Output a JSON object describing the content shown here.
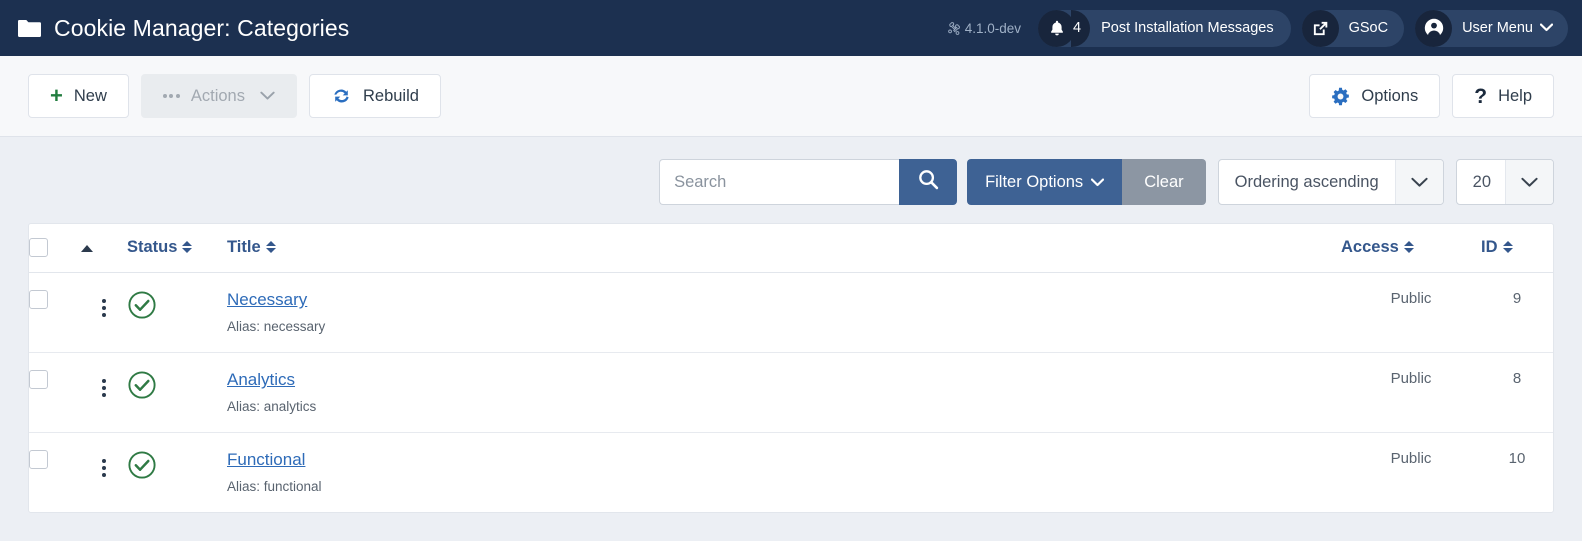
{
  "header": {
    "folder_icon": "folder-icon",
    "title": "Cookie Manager: Categories",
    "version": "4.1.0-dev",
    "joomla_icon": "joomla-logo-icon",
    "notifications": {
      "icon": "bell-icon",
      "count": "4",
      "label": "Post Installation Messages"
    },
    "gsoc": {
      "icon": "external-link-icon",
      "label": "GSoC"
    },
    "user_menu": {
      "icon": "user-avatar-icon",
      "label": "User Menu",
      "caret": "⌄"
    }
  },
  "toolbar": {
    "left": [
      {
        "name": "new-button",
        "icon": "plus-icon",
        "label": "New",
        "disabled": false
      },
      {
        "name": "actions-button",
        "icon": "ellipsis-icon",
        "label": "Actions",
        "disabled": true
      },
      {
        "name": "rebuild-button",
        "icon": "refresh-icon",
        "label": "Rebuild",
        "disabled": false
      }
    ],
    "right": [
      {
        "name": "options-button",
        "icon": "gear-icon",
        "label": "Options"
      },
      {
        "name": "help-button",
        "icon": "question-icon",
        "label": "Help"
      }
    ]
  },
  "filterbar": {
    "search": {
      "placeholder": "Search",
      "value": "",
      "button_icon": "search-icon"
    },
    "filter_options_label": "Filter Options",
    "filter_options_caret": "⌄",
    "clear_label": "Clear",
    "ordering": {
      "selected": "Ordering ascending",
      "caret": "⌄"
    },
    "limit": {
      "selected": "20",
      "caret": "⌄"
    }
  },
  "table": {
    "columns": [
      {
        "key": "check",
        "label": "",
        "sortable": false
      },
      {
        "key": "order",
        "label": "",
        "sortable": false,
        "icon": "sort-asc-arrow-icon"
      },
      {
        "key": "status",
        "label": "Status",
        "sortable": true
      },
      {
        "key": "title",
        "label": "Title",
        "sortable": true
      },
      {
        "key": "access",
        "label": "Access",
        "sortable": true
      },
      {
        "key": "id",
        "label": "ID",
        "sortable": true
      }
    ],
    "alias_prefix": "Alias: ",
    "rows": [
      {
        "title": "Necessary",
        "alias": "Alias: necessary",
        "status_icon": "check-circle-icon",
        "access": "Public",
        "id": "9"
      },
      {
        "title": "Analytics",
        "alias": "Alias: analytics",
        "status_icon": "check-circle-icon",
        "access": "Public",
        "id": "8"
      },
      {
        "title": "Functional",
        "alias": "Alias: functional",
        "status_icon": "check-circle-icon",
        "access": "Public",
        "id": "10"
      }
    ]
  },
  "colors": {
    "header_bg": "#1c3050",
    "toolbar_bg": "#f7f8fa",
    "page_bg": "#eceff4",
    "accent_blue": "#3e6294",
    "link_blue": "#2e6bb8",
    "heading_blue": "#34578c",
    "status_green": "#2f7a44",
    "clear_grey": "#8c96a3"
  }
}
